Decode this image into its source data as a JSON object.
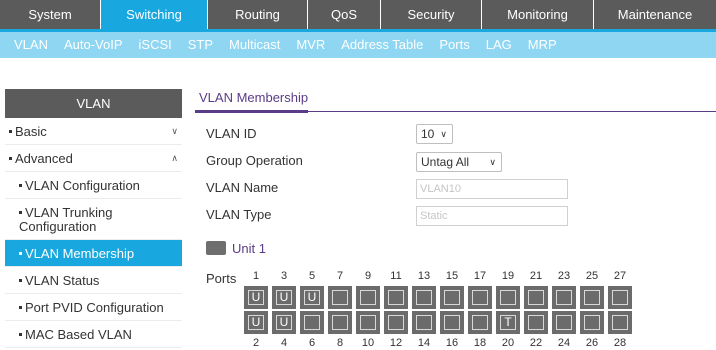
{
  "top_nav": [
    "System",
    "Switching",
    "Routing",
    "QoS",
    "Security",
    "Monitoring",
    "Maintenance"
  ],
  "top_nav_active": "Switching",
  "sub_nav": [
    "VLAN",
    "Auto-VoIP",
    "iSCSI",
    "STP",
    "Multicast",
    "MVR",
    "Address Table",
    "Ports",
    "LAG",
    "MRP"
  ],
  "sub_nav_active": "VLAN",
  "sidebar": {
    "header": "VLAN",
    "items": [
      {
        "label": "Basic",
        "level": 1,
        "chevron": "chevron-down"
      },
      {
        "label": "Advanced",
        "level": 1,
        "chevron": "chevron-up"
      },
      {
        "label": "VLAN Configuration",
        "level": 2
      },
      {
        "label": "VLAN Trunking Configuration",
        "level": 2
      },
      {
        "label": "VLAN Membership",
        "level": 2,
        "active": true
      },
      {
        "label": "VLAN Status",
        "level": 2
      },
      {
        "label": "Port PVID Configuration",
        "level": 2
      },
      {
        "label": "MAC Based VLAN",
        "level": 2
      }
    ]
  },
  "content": {
    "section_title": "VLAN Membership",
    "vlan_id_label": "VLAN ID",
    "vlan_id_value": "10",
    "group_operation_label": "Group Operation",
    "group_operation_value": "Untag All",
    "vlan_name_label": "VLAN Name",
    "vlan_name_value": "VLAN10",
    "vlan_type_label": "VLAN Type",
    "vlan_type_value": "Static",
    "unit_label": "Unit 1",
    "ports_label": "Ports"
  },
  "ports": {
    "top_row_numbers": [
      "1",
      "3",
      "5",
      "7",
      "9",
      "11",
      "13",
      "15",
      "17",
      "19",
      "21",
      "23",
      "25",
      "27"
    ],
    "bottom_row_numbers": [
      "2",
      "4",
      "6",
      "8",
      "10",
      "12",
      "14",
      "16",
      "18",
      "20",
      "22",
      "24",
      "26",
      "28"
    ],
    "top_row_status": [
      "U",
      "U",
      "U",
      "",
      "",
      "",
      "",
      "",
      "",
      "",
      "",
      "",
      "",
      ""
    ],
    "bottom_row_status": [
      "U",
      "U",
      "",
      "",
      "",
      "",
      "",
      "",
      "",
      "T",
      "",
      "",
      "",
      ""
    ]
  },
  "colors": {
    "accent": "#19a7e0",
    "subnav": "#8fd6f2",
    "nav_dark": "#5b5b5b",
    "section_purple": "#5b3c88",
    "port_gray": "#6b6b6b"
  }
}
